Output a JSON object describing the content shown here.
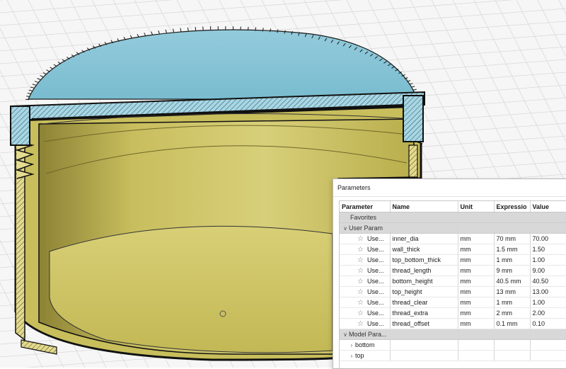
{
  "viewport": {
    "canvas_label": "3D model cross-section"
  },
  "colors": {
    "cap_top": "#86c4d6",
    "cap_hatch": "#9fd0e0",
    "body_fill": "#c9bf5f",
    "body_dark": "#8d8436",
    "body_light": "#ddd48a",
    "grid": "#d4d4d4",
    "group_row": "#d8d8d8"
  },
  "dialog": {
    "title": "Parameters",
    "columns": {
      "parameter": "Parameter",
      "name": "Name",
      "unit": "Unit",
      "expression": "Expressio",
      "value": "Value"
    },
    "favorites_label": "Favorites",
    "user_params_label": "User Param",
    "user_param_short": "Use...",
    "user_params": [
      {
        "name": "inner_dia",
        "unit": "mm",
        "expression": "70 mm",
        "value": "70.00"
      },
      {
        "name": "wall_thick",
        "unit": "mm",
        "expression": "1.5 mm",
        "value": "1.50"
      },
      {
        "name": "top_bottom_thick",
        "unit": "mm",
        "expression": "1 mm",
        "value": "1.00"
      },
      {
        "name": "thread_length",
        "unit": "mm",
        "expression": "9 mm",
        "value": "9.00"
      },
      {
        "name": "bottom_height",
        "unit": "mm",
        "expression": "40.5 mm",
        "value": "40.50"
      },
      {
        "name": "top_height",
        "unit": "mm",
        "expression": "13 mm",
        "value": "13.00"
      },
      {
        "name": "thread_clear",
        "unit": "mm",
        "expression": "1 mm",
        "value": "1.00"
      },
      {
        "name": "thread_extra",
        "unit": "mm",
        "expression": "2 mm",
        "value": "2.00"
      },
      {
        "name": "thread_offset",
        "unit": "mm",
        "expression": "0.1 mm",
        "value": "0.10"
      }
    ],
    "model_params_label": "Model Para...",
    "model_children": [
      "bottom",
      "top"
    ],
    "icons": {
      "expanded": "chevron-down-icon",
      "collapsed": "chevron-right-icon",
      "favorite": "star-icon"
    }
  }
}
